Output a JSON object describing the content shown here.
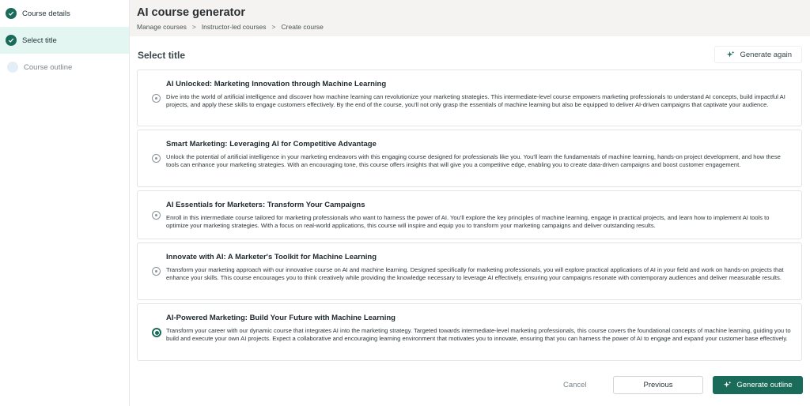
{
  "colors": {
    "accent": "#1b6b5a",
    "active_step_bg": "#e3f6f1",
    "header_bg": "#f4f3f1"
  },
  "sidebar": {
    "steps": [
      {
        "label": "Course details",
        "state": "done",
        "icon": "check-icon"
      },
      {
        "label": "Select title",
        "state": "active",
        "icon": "check-icon"
      },
      {
        "label": "Course outline",
        "state": "pending",
        "icon": "empty-circle-icon"
      }
    ]
  },
  "header": {
    "title": "AI course generator",
    "breadcrumb": [
      "Manage courses",
      "Instructor-led courses",
      "Create course"
    ],
    "separator": ">"
  },
  "main": {
    "section_title": "Select title",
    "generate_again_label": "Generate again",
    "options": [
      {
        "title": "AI Unlocked: Marketing Innovation through Machine Learning",
        "description": "Dive into the world of artificial intelligence and discover how machine learning can revolutionize your marketing strategies. This intermediate-level course empowers marketing professionals to understand AI concepts, build impactful AI projects, and apply these skills to engage customers effectively. By the end of the course, you'll not only grasp the essentials of machine learning but also be equipped to deliver AI-driven campaigns that captivate your audience.",
        "selected": false
      },
      {
        "title": "Smart Marketing: Leveraging AI for Competitive Advantage",
        "description": "Unlock the potential of artificial intelligence in your marketing endeavors with this engaging course designed for professionals like you. You'll learn the fundamentals of machine learning, hands-on project development, and how these tools can enhance your marketing strategies. With an encouraging tone, this course offers insights that will give you a competitive edge, enabling you to create data-driven campaigns and boost customer engagement.",
        "selected": false
      },
      {
        "title": "AI Essentials for Marketers: Transform Your Campaigns",
        "description": "Enroll in this intermediate course tailored for marketing professionals who want to harness the power of AI. You'll explore the key principles of machine learning, engage in practical projects, and learn how to implement AI tools to optimize your marketing strategies. With a focus on real-world applications, this course will inspire and equip you to transform your marketing campaigns and deliver outstanding results.",
        "selected": false
      },
      {
        "title": "Innovate with AI: A Marketer's Toolkit for Machine Learning",
        "description": "Transform your marketing approach with our innovative course on AI and machine learning. Designed specifically for marketing professionals, you will explore practical applications of AI in your field and work on hands-on projects that enhance your skills. This course encourages you to think creatively while providing the knowledge necessary to leverage AI effectively, ensuring your campaigns resonate with contemporary audiences and deliver measurable results.",
        "selected": false
      },
      {
        "title": "AI-Powered Marketing: Build Your Future with Machine Learning",
        "description": "Transform your career with our dynamic course that integrates AI into the marketing strategy. Targeted towards intermediate-level marketing professionals, this course covers the foundational concepts of machine learning, guiding you to build and execute your own AI projects. Expect a collaborative and encouraging learning environment that motivates you to innovate, ensuring that you can harness the power of AI to engage and expand your customer base effectively.",
        "selected": true
      }
    ]
  },
  "footer": {
    "cancel_label": "Cancel",
    "previous_label": "Previous",
    "generate_outline_label": "Generate outline"
  }
}
